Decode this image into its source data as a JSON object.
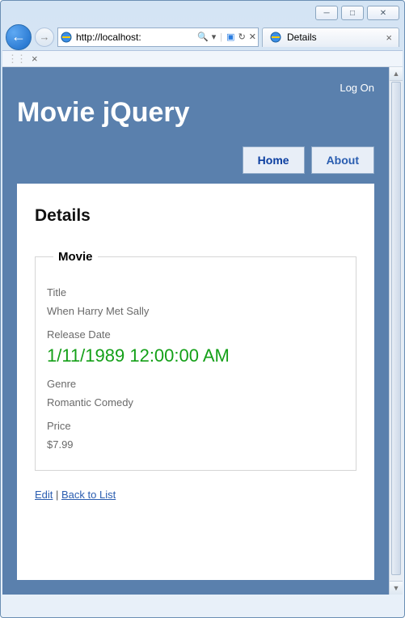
{
  "window": {
    "minimize": "—",
    "maximize": "▢",
    "close": "✕"
  },
  "nav": {
    "back": "←",
    "forward": "→",
    "address": "http://localhost:",
    "search_icon": "🔍",
    "refresh": "↻",
    "stop": "✕",
    "compat_glyph": "▣",
    "dropdown": "▾"
  },
  "tab": {
    "title": "Details",
    "close": "×"
  },
  "toolrow": {
    "close": "×"
  },
  "header": {
    "logon": "Log On",
    "app_title": "Movie jQuery"
  },
  "navtabs": {
    "home": "Home",
    "about": "About"
  },
  "page": {
    "heading": "Details",
    "legend": "Movie",
    "fields": {
      "title_label": "Title",
      "title_value": "When Harry Met Sally",
      "release_label": "Release Date",
      "release_value": "1/11/1989 12:00:00 AM",
      "genre_label": "Genre",
      "genre_value": "Romantic Comedy",
      "price_label": "Price",
      "price_value": "$7.99"
    },
    "links": {
      "edit": "Edit",
      "sep": " | ",
      "back": "Back to List"
    }
  }
}
